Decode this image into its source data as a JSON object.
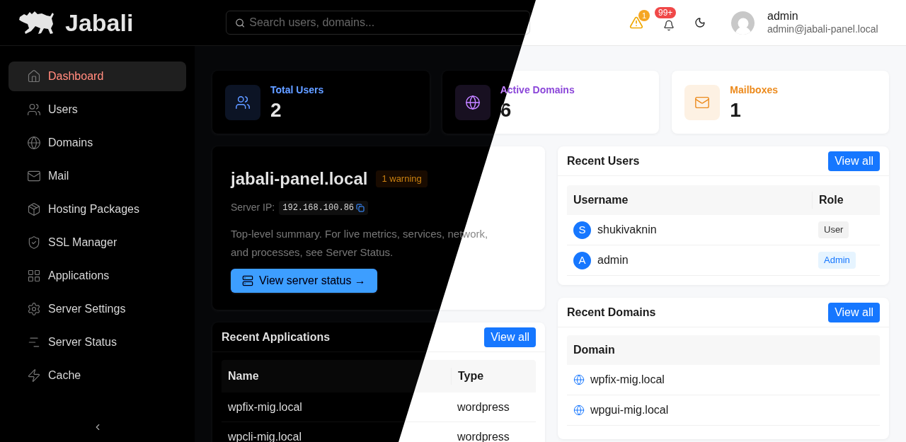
{
  "brand": {
    "name": "Jabali"
  },
  "search": {
    "placeholder": "Search users, domains..."
  },
  "header": {
    "warning_count": "1",
    "notification_count": "99+",
    "user": {
      "name": "admin",
      "email": "admin@jabali-panel.local"
    }
  },
  "sidebar": {
    "items": [
      {
        "label": "Dashboard",
        "selected": true
      },
      {
        "label": "Users",
        "selected": false
      },
      {
        "label": "Domains",
        "selected": false
      },
      {
        "label": "Mail",
        "selected": false
      },
      {
        "label": "Hosting Packages",
        "selected": false
      },
      {
        "label": "SSL Manager",
        "selected": false
      },
      {
        "label": "Applications",
        "selected": false
      },
      {
        "label": "Server Settings",
        "selected": false
      },
      {
        "label": "Server Status",
        "selected": false
      },
      {
        "label": "Cache",
        "selected": false
      }
    ]
  },
  "stats": [
    {
      "label": "Total Users",
      "value": "2",
      "kind": "users"
    },
    {
      "label": "Active Domains",
      "value": "6",
      "kind": "domains"
    },
    {
      "label": "Mailboxes",
      "value": "1",
      "kind": "mail"
    }
  ],
  "server": {
    "hostname": "jabali-panel.local",
    "badge": "1 warning",
    "ip_label": "Server IP:",
    "ip": "192.168.100.86",
    "summary": "Top-level summary. For live metrics, services, network, and processes, see Server Status.",
    "button": "View server status →"
  },
  "recent_applications": {
    "title": "Recent Applications",
    "action": "View all",
    "columns": [
      "Name",
      "Type"
    ],
    "rows": [
      [
        "wpfix-mig.local",
        "wordpress"
      ],
      [
        "wpcli-mig.local",
        "wordpress"
      ]
    ]
  },
  "recent_users": {
    "title": "Recent Users",
    "action": "View all",
    "columns": [
      "Username",
      "Role"
    ],
    "rows": [
      {
        "initial": "S",
        "username": "shukivaknin",
        "role": "User",
        "kind": "user"
      },
      {
        "initial": "A",
        "username": "admin",
        "role": "Admin",
        "kind": "admin"
      }
    ]
  },
  "recent_domains": {
    "title": "Recent Domains",
    "action": "View all",
    "columns": [
      "Domain"
    ],
    "rows": [
      "wpfix-mig.local",
      "wpgui-mig.local"
    ]
  }
}
